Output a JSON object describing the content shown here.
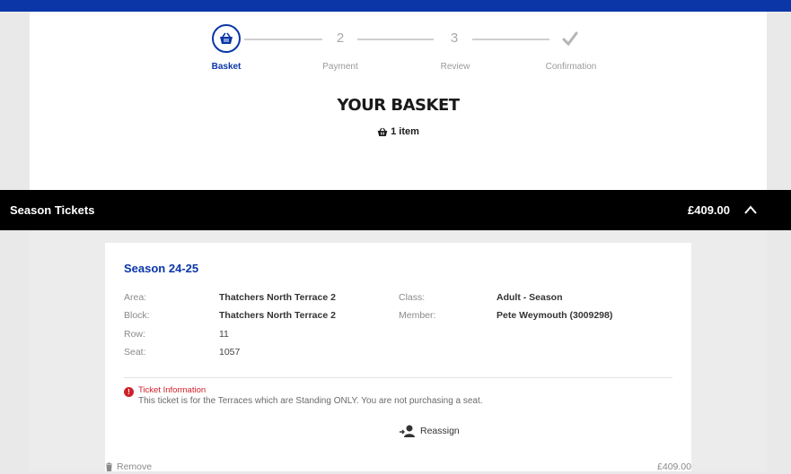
{
  "stepper": {
    "steps": [
      {
        "label": "Basket",
        "number": ""
      },
      {
        "label": "Payment",
        "number": "2"
      },
      {
        "label": "Review",
        "number": "3"
      },
      {
        "label": "Confirmation",
        "number": ""
      }
    ]
  },
  "basket": {
    "title": "YOUR BASKET",
    "item_count": "1 item"
  },
  "section": {
    "label": "Season Tickets",
    "price": "£409.00"
  },
  "ticket": {
    "title": "Season 24-25",
    "fields_left": [
      {
        "label": "Area:",
        "value": "Thatchers North Terrace 2"
      },
      {
        "label": "Block:",
        "value": "Thatchers North Terrace 2"
      },
      {
        "label": "Row:",
        "value": "11"
      },
      {
        "label": "Seat:",
        "value": "1057"
      }
    ],
    "fields_right": [
      {
        "label": "Class:",
        "value": "Adult - Season"
      },
      {
        "label": "Member:",
        "value": "Pete Weymouth (3009298)"
      }
    ],
    "info_title": "Ticket Information",
    "info_text": "This ticket is for the Terraces which are Standing ONLY. You are not purchasing a seat.",
    "reassign_label": "Reassign"
  },
  "footer": {
    "remove_label": "Remove",
    "price": "£409.00"
  },
  "colors": {
    "accent": "#0a36a8",
    "alert": "#d0202a"
  }
}
